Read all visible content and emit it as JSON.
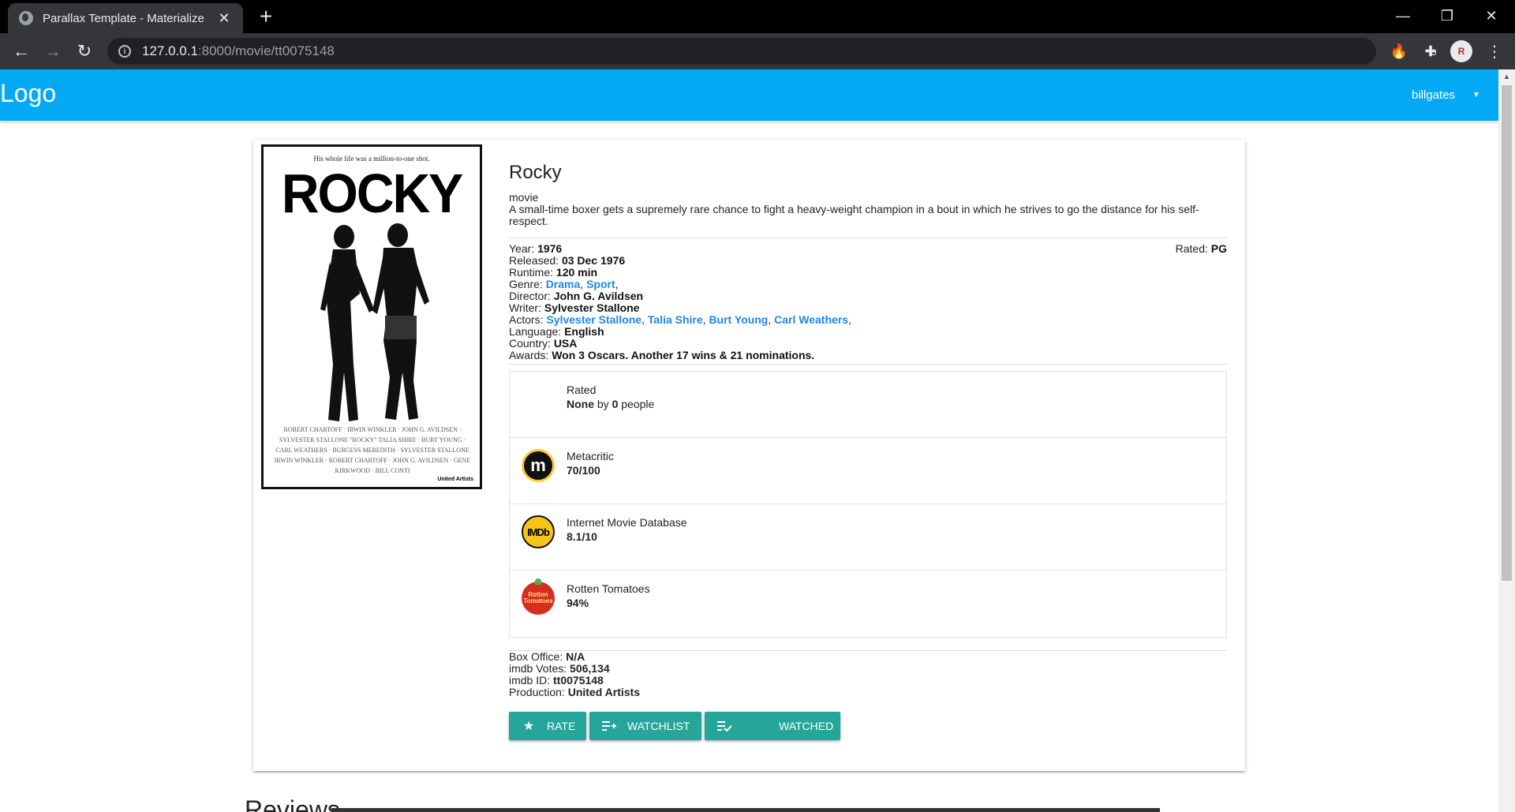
{
  "browser": {
    "tab_title": "Parallax Template - Materialize",
    "url_host": "127.0.0.1",
    "url_rest": ":8000/movie/tt0075148",
    "profile_initials": "R"
  },
  "navbar": {
    "logo": "Logo",
    "username": "billgates",
    "color": "#03a9f4"
  },
  "poster": {
    "tagline": "His whole life was a million-to-one shot.",
    "title": "ROCKY",
    "credits": "ROBERT CHARTOFF · IRWIN WINKLER · JOHN G. AVILDSEN · SYLVESTER STALLONE \"ROCKY\" TALIA SHIRE · BURT YOUNG · CARL WEATHERS · BURGESS MEREDITH · SYLVESTER STALLONE IRWIN WINKLER · ROBERT CHARTOFF · JOHN G. AVILDSEN · GENE KIRKWOOD · BILL CONTI",
    "studio": "United Artists"
  },
  "movie": {
    "title": "Rocky",
    "type": "movie",
    "plot": "A small-time boxer gets a supremely rare chance to fight a heavy-weight champion in a bout in which he strives to go the distance for his self-respect.",
    "rated_label": "Rated: ",
    "rated": "PG",
    "year_label": "Year: ",
    "year": "1976",
    "released_label": "Released: ",
    "released": "03 Dec 1976",
    "runtime_label": "Runtime: ",
    "runtime": "120 min",
    "genre_label": "Genre: ",
    "genres": [
      "Drama",
      "Sport"
    ],
    "director_label": "Director: ",
    "director": "John G. Avildsen",
    "writer_label": "Writer: ",
    "writer": "Sylvester Stallone",
    "actors_label": "Actors: ",
    "actors": [
      "Sylvester Stallone",
      "Talia Shire",
      "Burt Young",
      "Carl Weathers"
    ],
    "language_label": "Language: ",
    "language": "English",
    "country_label": "Country: ",
    "country": "USA",
    "awards_label": "Awards: ",
    "awards": "Won 3 Oscars. Another 17 wins & 21 nominations."
  },
  "ratings": {
    "user": {
      "label": "Rated",
      "value": "None",
      "by": " by ",
      "count": "0",
      "people": " people"
    },
    "metacritic": {
      "label": "Metacritic",
      "value": "70/100",
      "icon": "metacritic-icon"
    },
    "imdb": {
      "label": "Internet Movie Database",
      "value": "8.1/10",
      "icon": "imdb-icon",
      "logo_text": "IMDb"
    },
    "rotten": {
      "label": "Rotten Tomatoes",
      "value": "94%",
      "icon": "rotten-tomatoes-icon",
      "logo_text": "Rotten Tomatoes"
    }
  },
  "extra": {
    "box_office_label": "Box Office: ",
    "box_office": "N/A",
    "votes_label": "imdb Votes: ",
    "votes": "506,134",
    "imdb_id_label": "imdb ID: ",
    "imdb_id": "tt0075148",
    "production_label": "Production: ",
    "production": "United Artists"
  },
  "buttons": {
    "rate": "RATE",
    "watchlist": "WATCHLIST",
    "watched": "WATCHED",
    "color": "#26a69a"
  },
  "reviews": {
    "heading": "Reviews"
  }
}
